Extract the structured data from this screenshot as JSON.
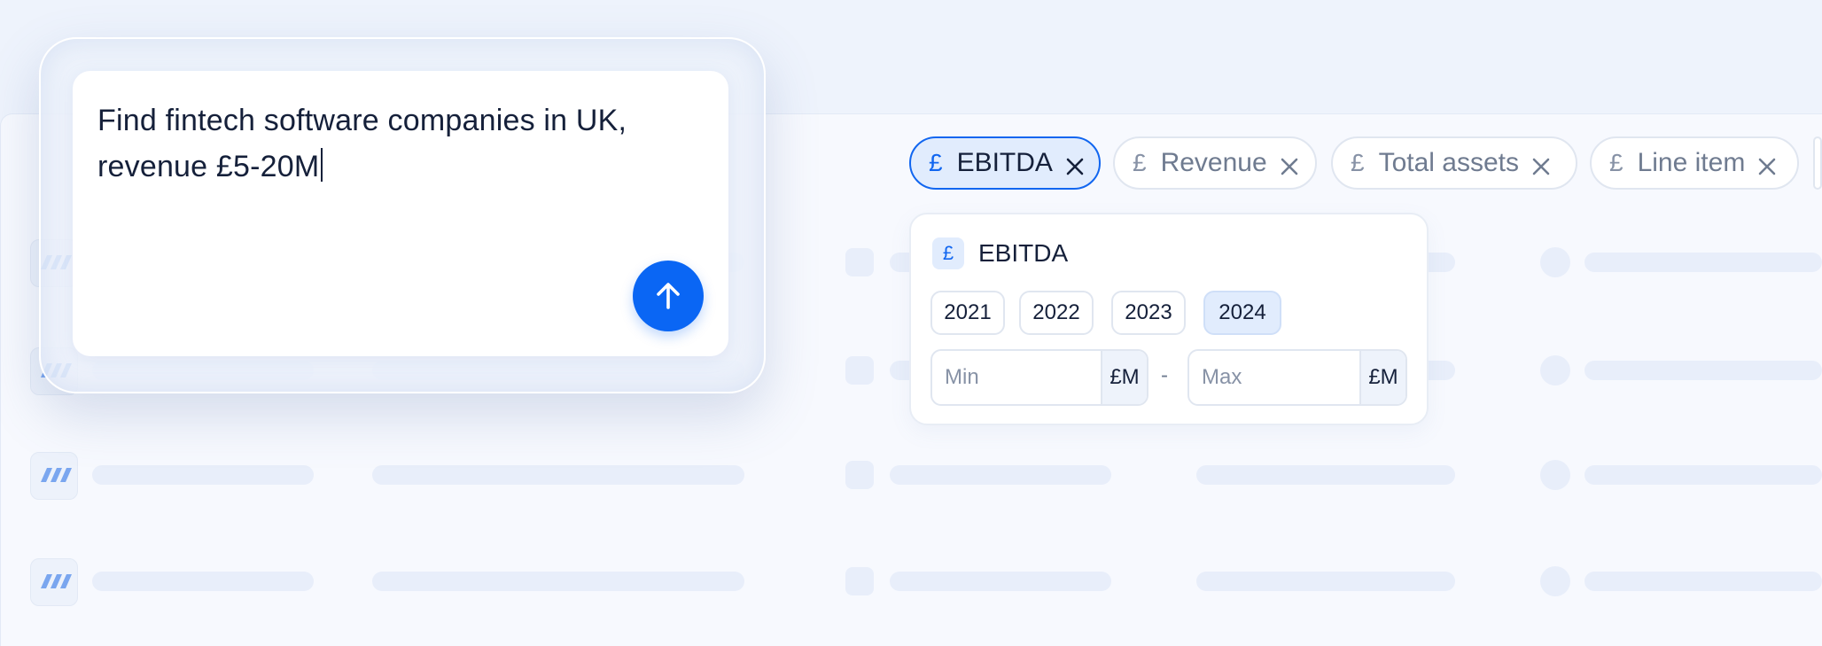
{
  "prompt": {
    "text": "Find fintech software companies in UK, revenue £5-20M",
    "send_label": "Send"
  },
  "filter_chips": [
    {
      "label": "EBITDA",
      "currency": "£",
      "active": true
    },
    {
      "label": "Revenue",
      "currency": "£",
      "active": false
    },
    {
      "label": "Total assets",
      "currency": "£",
      "active": false
    },
    {
      "label": "Line item",
      "currency": "£",
      "active": false
    }
  ],
  "ebitda_filter": {
    "icon": "£",
    "title": "EBITDA",
    "years": [
      "2021",
      "2022",
      "2023",
      "2024"
    ],
    "selected_year": "2024",
    "min_placeholder": "Min",
    "max_placeholder": "Max",
    "unit": "£M",
    "separator": "-"
  },
  "colors": {
    "accent": "#0A66F4",
    "chip_active_bg": "#E1ECFD",
    "background": "#EEF3FC"
  },
  "icons": {
    "send": "arrow-up-icon",
    "chip_remove": "close-icon",
    "row_logo": "stripes-logo-icon"
  }
}
